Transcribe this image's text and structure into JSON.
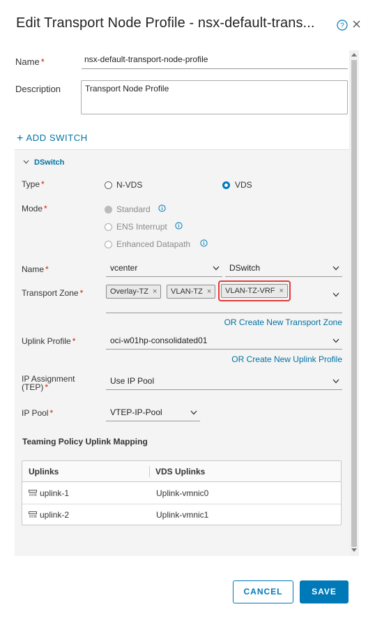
{
  "dialog": {
    "title": "Edit Transport Node Profile - nsx-default-trans...",
    "help_icon": "help-circle-icon",
    "close_icon": "close-icon"
  },
  "form": {
    "name_label": "Name",
    "name_value": "nsx-default-transport-node-profile",
    "description_label": "Description",
    "description_value": "Transport Node Profile",
    "add_switch_label": "ADD SWITCH",
    "required_mark": "*"
  },
  "switch": {
    "header": "DSwitch",
    "type_label": "Type",
    "type_options": [
      {
        "label": "N-VDS",
        "checked": false
      },
      {
        "label": "VDS",
        "checked": true
      }
    ],
    "mode_label": "Mode",
    "mode_options": [
      {
        "label": "Standard",
        "checked": true,
        "disabled": true
      },
      {
        "label": "ENS Interrupt",
        "checked": false,
        "disabled": true
      },
      {
        "label": "Enhanced Datapath",
        "checked": false,
        "disabled": true
      }
    ],
    "name_label": "Name",
    "name_vcenter": "vcenter",
    "name_dswitch": "DSwitch",
    "transport_zone_label": "Transport Zone",
    "transport_zones": [
      "Overlay-TZ",
      "VLAN-TZ",
      "VLAN-TZ-VRF"
    ],
    "create_tz_link": "OR Create New Transport Zone",
    "uplink_profile_label": "Uplink Profile",
    "uplink_profile_value": "oci-w01hp-consolidated01",
    "create_uplink_link": "OR Create New Uplink Profile",
    "ip_assignment_label_1": "IP Assignment",
    "ip_assignment_label_2": "(TEP)",
    "ip_assignment_value": "Use IP Pool",
    "ip_pool_label": "IP Pool",
    "ip_pool_value": "VTEP-IP-Pool",
    "teaming_header": "Teaming Policy Uplink Mapping",
    "table": {
      "columns": [
        "Uplinks",
        "VDS Uplinks"
      ],
      "rows": [
        {
          "uplink": "uplink-1",
          "vds_uplink": "Uplink-vmnic0"
        },
        {
          "uplink": "uplink-2",
          "vds_uplink": "Uplink-vmnic1"
        }
      ]
    }
  },
  "footer": {
    "cancel_label": "CANCEL",
    "save_label": "SAVE"
  },
  "colors": {
    "accent": "#0079b8",
    "required": "#c92100",
    "highlight": "#e03c3c"
  }
}
